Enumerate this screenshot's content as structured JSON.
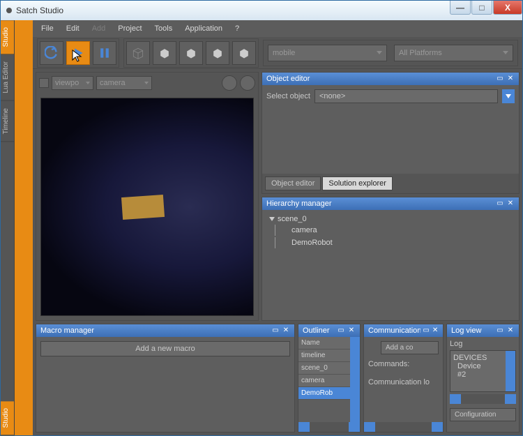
{
  "window": {
    "title": "Satch Studio"
  },
  "side_tabs": {
    "t0": "Studio",
    "t1": "Lua Editor",
    "t2": "Timeline",
    "bottom": "Studio"
  },
  "menu": {
    "file": "File",
    "edit": "Edit",
    "add": "Add",
    "project": "Project",
    "tools": "Tools",
    "application": "Application",
    "help": "?"
  },
  "toolbar": {
    "target_combo": "mobile",
    "platform_combo": "All Platforms"
  },
  "viewport": {
    "combo1": "viewpo",
    "combo2": "camera"
  },
  "object_editor": {
    "title": "Object editor",
    "select_label": "Select object",
    "selected": "<none>",
    "tab1": "Object editor",
    "tab2": "Solution explorer"
  },
  "hierarchy": {
    "title": "Hierarchy manager",
    "root": "scene_0",
    "child1": "camera",
    "child2": "DemoRobot"
  },
  "macro": {
    "title": "Macro manager",
    "add_btn": "Add a new macro"
  },
  "outliner": {
    "title": "Outliner",
    "items": {
      "i0": "Name",
      "i1": "timeline",
      "i2": "scene_0",
      "i3": "camera",
      "i4": "DemoRob"
    }
  },
  "comm": {
    "title": "Communication co",
    "add_btn": "Add a co",
    "label1": "Commands:",
    "label2": "Communication lo"
  },
  "log": {
    "title": "Log view",
    "header": "Log",
    "line1": "DEVICES",
    "line2": "Device",
    "line3": "#2",
    "config": "Configuration"
  }
}
